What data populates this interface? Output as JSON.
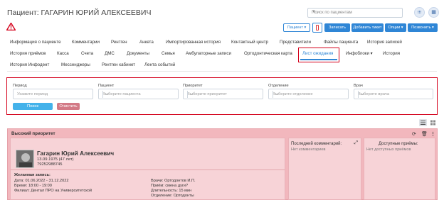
{
  "header": {
    "title": "Пациент: ГАГАРИН ЮРИЙ АЛЕКСЕЕВИЧ",
    "search_placeholder": "Поиск по пациентам",
    "info_icon_label": "!!!"
  },
  "toolbar": {
    "patient_btn": "Пациент ▾",
    "record_btn": "Записать",
    "add_ticket_btn": "Добавить тикет",
    "options_btn": "Опции ▾",
    "call_btn": "Позвонить ▾"
  },
  "tabs_row1": [
    "Информация о пациенте",
    "Комментарии",
    "Рентген",
    "Анкета",
    "Импортированная история",
    "Контактный центр",
    "Представители",
    "Файлы пациента",
    "История записей"
  ],
  "tabs_row2": [
    "История приёмов",
    "Касса",
    "Счета",
    "ДМС",
    "Документы",
    "Семья",
    "Амбулаторные записи",
    "Ортодонтическая карта",
    "Лист ожидания",
    "Инфоблоки ▾",
    "История"
  ],
  "tabs_row3": [
    "История Инфодент",
    "Мессенджеры",
    "Рентген кабинет",
    "Лента событий"
  ],
  "filter": {
    "period_label": "Период",
    "period_placeholder": "Укажите период",
    "patient_label": "Пациент",
    "patient_placeholder": "Выберите пациента",
    "priority_label": "Приоритет",
    "priority_placeholder": "Выберите приоритет",
    "department_label": "Отделение",
    "department_placeholder": "Выберите отделение",
    "doctor_label": "Врач",
    "doctor_placeholder": "Выберите врача",
    "search_btn": "Поиск",
    "clear_btn": "Очистить"
  },
  "card": {
    "priority_title": "Высокий приоритет",
    "patient_name": "Гагарин Юрий Алексеевич",
    "birth": "13.09.1975 (47 лет)",
    "phone": "79252988745",
    "desired_title": "Желаемая запись:",
    "date": "Дата: 01.06.2022 - 31.12.2022",
    "time": "Время: 18:00 - 19:00",
    "branch": "Филиал: Дентал ПРО на Университетской",
    "doctor": "Врачи: Ортодонтов И.П.",
    "appointment": "Приём: смена дуги?",
    "duration": "Длительность: 15 мин",
    "department": "Отделение: Ортодонты",
    "last_comment_title": "Последний комментарий:",
    "last_comment_value": "Нет комментариев",
    "available_title": "Доступные приёмы:",
    "available_value": "Нет доступных приёмов"
  },
  "colors": {
    "accent": "#2f86d6",
    "highlight": "#d4001a",
    "card_bg": "#f2b7bd",
    "clear_btn": "#d37a86"
  }
}
